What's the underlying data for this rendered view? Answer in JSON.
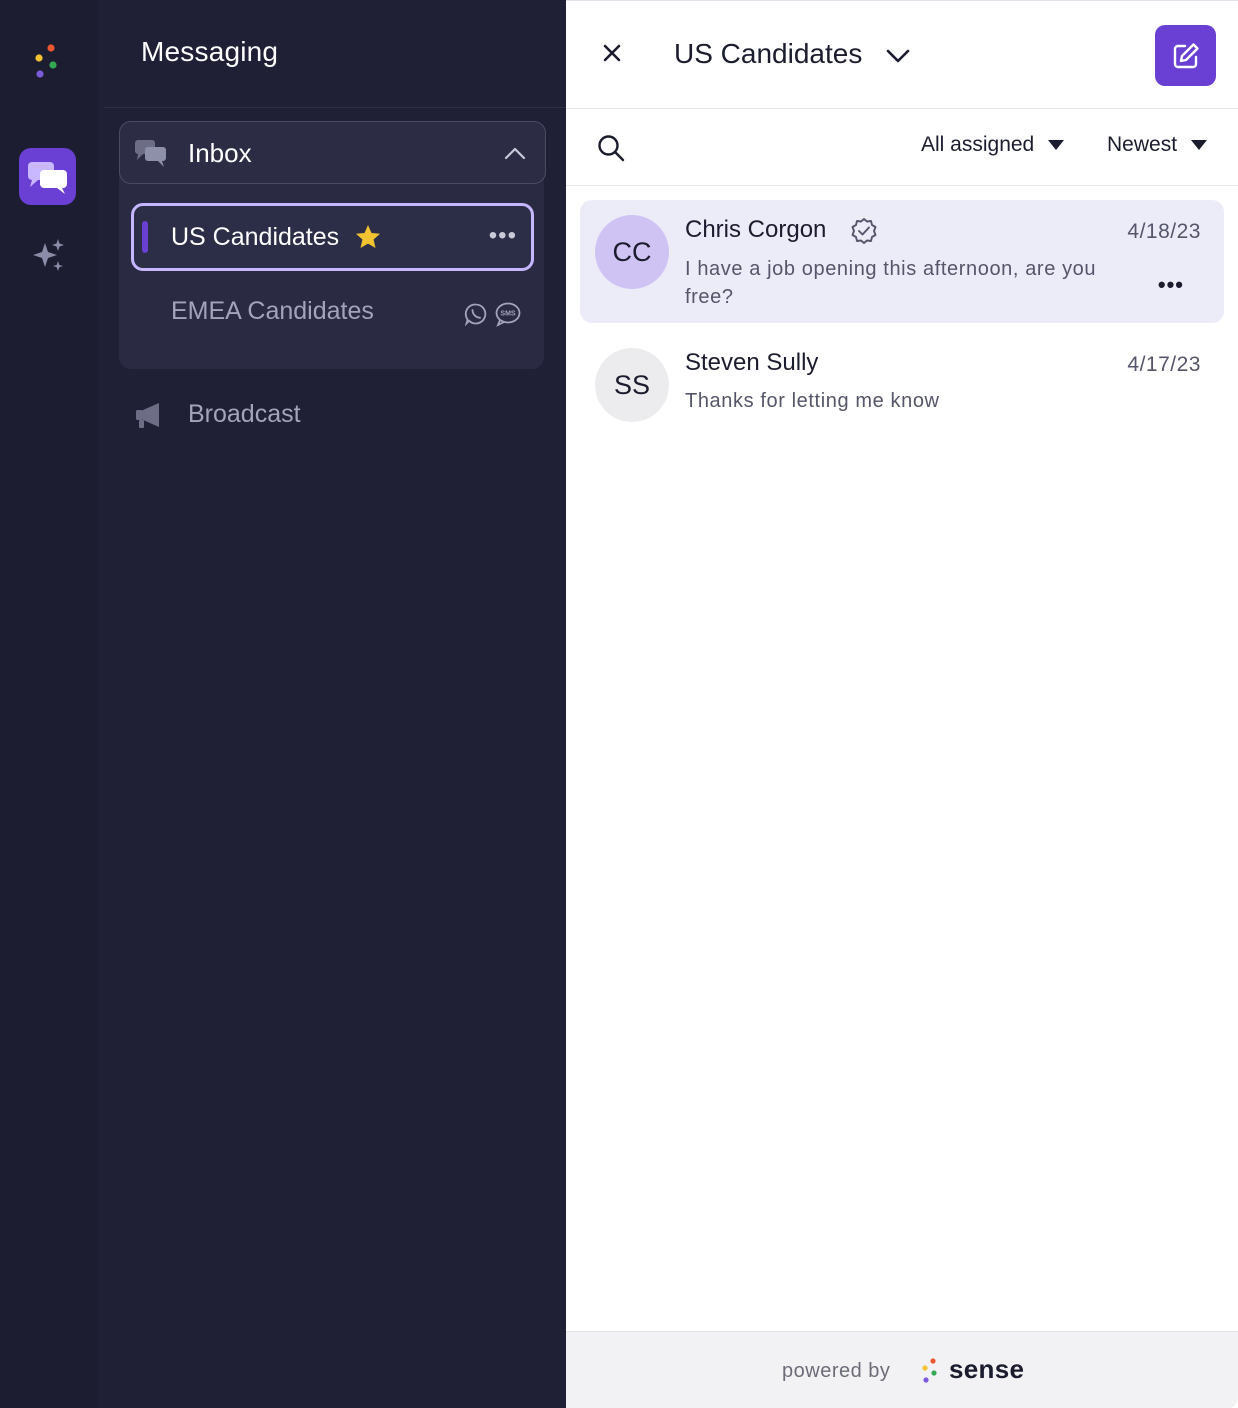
{
  "sidebar": {
    "title": "Messaging",
    "inbox": {
      "label": "Inbox",
      "items": [
        {
          "label": "US Candidates",
          "favorite": true,
          "selected": true
        },
        {
          "label": "EMEA Candidates",
          "channels": [
            "whatsapp-icon",
            "sms-icon"
          ],
          "sms_badge": "SMS"
        }
      ]
    },
    "broadcast": {
      "label": "Broadcast"
    }
  },
  "panel": {
    "title": "US Candidates",
    "filters": {
      "assigned": "All assigned",
      "sort": "Newest"
    },
    "conversations": [
      {
        "initials": "CC",
        "name": "Chris Corgon",
        "date": "4/18/23",
        "preview": "I have a job opening this afternoon, are you free?",
        "verified": true,
        "active": true
      },
      {
        "initials": "SS",
        "name": "Steven Sully",
        "date": "4/17/23",
        "preview": "Thanks for letting me know",
        "verified": false,
        "active": false
      }
    ],
    "more_label": "•••"
  },
  "footer": {
    "powered_by": "powered by",
    "brand": "sense"
  },
  "colors": {
    "accent": "#6a3fd4",
    "sidebar_bg": "#1f2035",
    "rail_bg": "#1c1d30",
    "selected_border": "#c6b6ff",
    "active_row": "#ecebf8",
    "star": "#f2c230"
  }
}
